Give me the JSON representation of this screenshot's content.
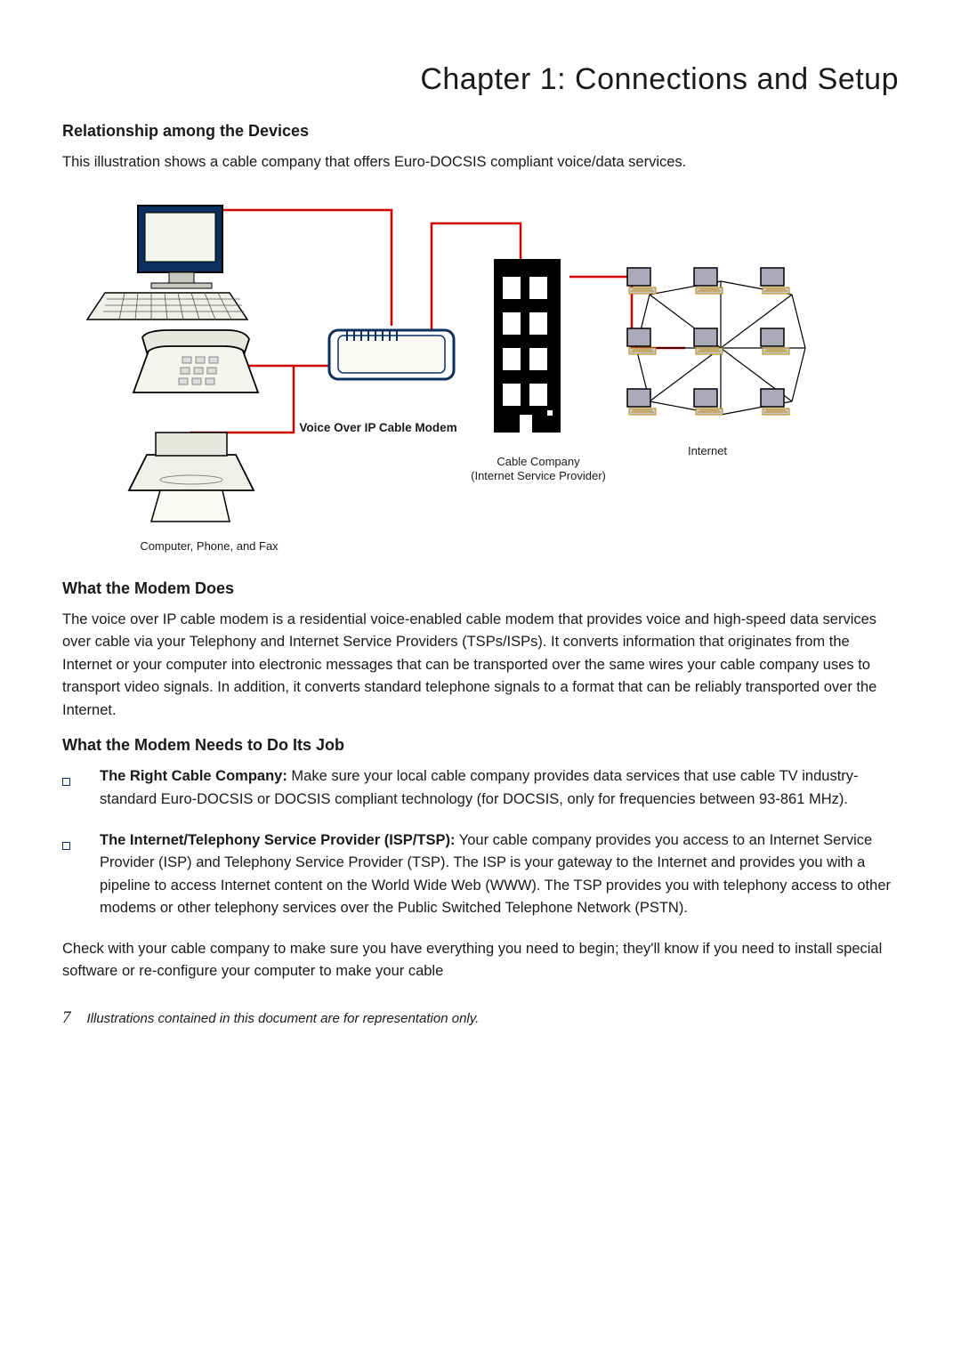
{
  "chapter_title": "Chapter 1: Connections and Setup",
  "section1": {
    "heading": "Relationship among the Devices",
    "intro": "This illustration shows a cable company that offers Euro-DOCSIS compliant voice/data services."
  },
  "diagram": {
    "caption_devices": "Computer, Phone, and Fax",
    "caption_modem": "Voice Over IP Cable Modem",
    "caption_isp_line1": "Cable Company",
    "caption_isp_line2": "(Internet Service Provider)",
    "caption_internet": "Internet"
  },
  "section2": {
    "heading": "What the Modem Does",
    "body": "The voice over IP cable modem is a residential voice-enabled cable modem that provides voice and high-speed data services over cable via your Telephony and Internet Service Providers (TSPs/ISPs). It converts information that originates from the Internet or your computer into electronic messages that can be transported over the same wires your cable company uses to transport video signals. In addition, it converts standard telephone signals to a format that can be reliably transported over the Internet."
  },
  "section3": {
    "heading": "What the Modem Needs to Do Its Job",
    "items": [
      {
        "lead": "The Right Cable Company:",
        "text": "   Make sure your local cable company provides data services that use cable TV industry-standard Euro-DOCSIS or DOCSIS compliant technology (for DOCSIS, only for frequencies between 93-861 MHz)."
      },
      {
        "lead": "The Internet/Telephony Service Provider (ISP/TSP):",
        "text": "   Your cable company provides you access to an Internet Service Provider (ISP) and Telephony Service Provider (TSP). The ISP is your gateway to the Internet and provides you with a pipeline to access Internet content on the World Wide Web (WWW). The TSP provides you with telephony access to other modems or other telephony services over the Public Switched Telephone Network (PSTN)."
      }
    ],
    "followup": "Check with your cable company to make sure you have everything you need to begin; they'll know if you need to install special software or re-configure your computer to make your cable"
  },
  "footer": {
    "page_number": "7",
    "note": "Illustrations contained in this document are for representation only."
  }
}
